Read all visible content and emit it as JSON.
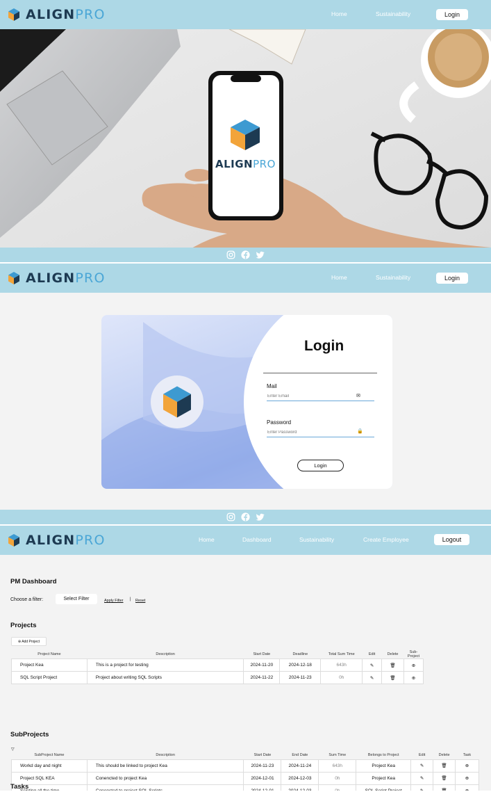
{
  "brand": {
    "align": "ALIGN",
    "pro": "PRO"
  },
  "section1": {
    "nav": {
      "home": "Home",
      "sustainability": "Sustainability",
      "login": "Login"
    }
  },
  "section2": {
    "nav": {
      "home": "Home",
      "sustainability": "Sustainability",
      "login": "Login"
    },
    "form": {
      "title": "Login",
      "mail_label": "Mail",
      "mail_placeholder": "Enter Email",
      "password_label": "Password",
      "password_placeholder": "Enter Password",
      "submit": "Login"
    }
  },
  "section3": {
    "nav": {
      "home": "Home",
      "dashboard": "Dashboard",
      "sustainability": "Sustainability",
      "create_employee": "Create Employee",
      "logout": "Logout"
    },
    "title": "PM Dashboard",
    "filter_label": "Choose a filter:",
    "filter_select": "Select Filter",
    "apply_filter": "Apply Filter",
    "divider": "|",
    "reset": "Reset",
    "projects_title": "Projects",
    "add_project": "⊕ Add Project",
    "projects_headers": [
      "Project Name",
      "Description",
      "Start Date",
      "Deadline",
      "Total Sum Time",
      "Edit",
      "Delete",
      "Sub-Project"
    ],
    "projects": [
      {
        "name": "Project Kea",
        "description": "This is a project for testing",
        "start": "2024-11-20",
        "deadline": "2024-12-18",
        "sum": "643h"
      },
      {
        "name": "SQL Script Project",
        "description": "Project about writing SQL Scripts",
        "start": "2024-11-22",
        "deadline": "2024-11-23",
        "sum": "0h"
      }
    ],
    "subprojects_title": "SubProjects",
    "subprojects_headers": [
      "SubProject Name",
      "Description",
      "Start Date",
      "End Date",
      "Sum Time",
      "Belongs to Project",
      "Edit",
      "Delete",
      "Task"
    ],
    "subprojects": [
      {
        "name": "Workd day and night",
        "description": "This should be linked to project Kea",
        "start": "2024-11-23",
        "end": "2024-11-24",
        "sum": "643h",
        "project": "Project Kea"
      },
      {
        "name": "Project SQL KEA",
        "description": "Conencted to project Kea",
        "start": "2024-12-01",
        "end": "2024-12-03",
        "sum": "0h",
        "project": "Project Kea"
      },
      {
        "name": "Scipting all the time",
        "description": "Conencted to project SQL Scripts",
        "start": "2024-12-01",
        "end": "2024-12-03",
        "sum": "0h",
        "project": "SQL Script Project"
      }
    ],
    "tasks_title": "Tasks"
  }
}
